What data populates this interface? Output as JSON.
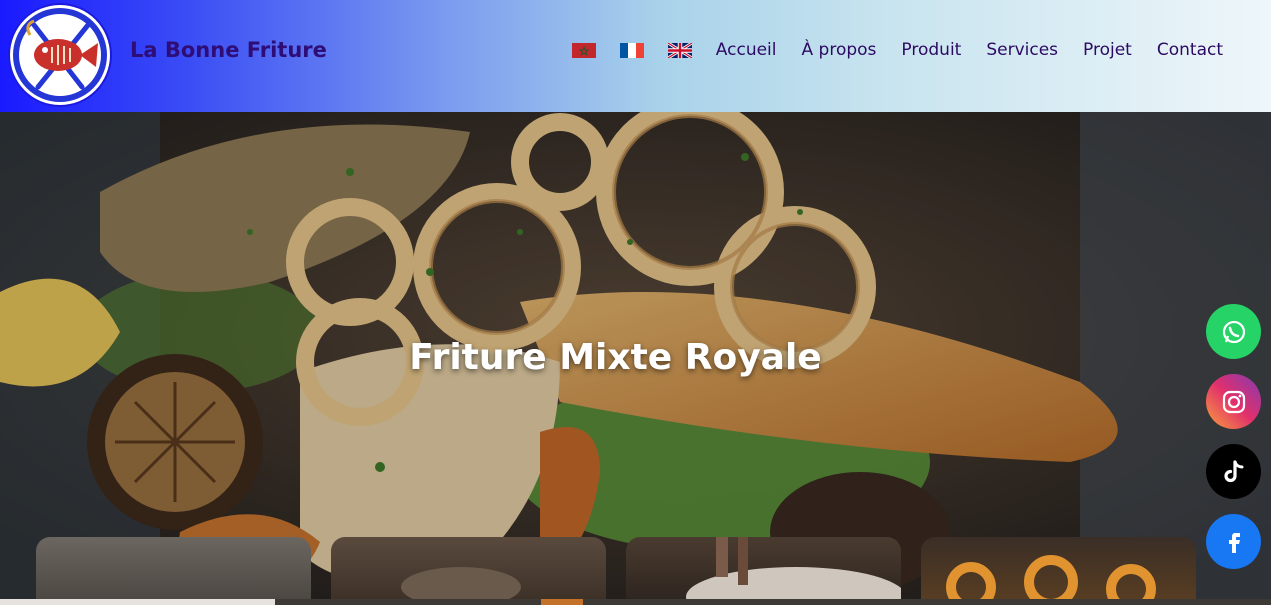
{
  "header": {
    "brand": "La Bonne Friture",
    "nav": [
      "Accueil",
      "À propos",
      "Produit",
      "Services",
      "Projet",
      "Contact"
    ],
    "languages": [
      {
        "name": "morocco-flag-icon"
      },
      {
        "name": "france-flag-icon"
      },
      {
        "name": "uk-flag-icon"
      }
    ]
  },
  "hero": {
    "title": "Friture Mixte Royale"
  },
  "social": [
    {
      "name": "whatsapp-icon",
      "color": "#25d366"
    },
    {
      "name": "instagram-icon",
      "color": "#e1306c"
    },
    {
      "name": "tiktok-icon",
      "color": "#000000"
    },
    {
      "name": "facebook-icon",
      "color": "#1877f2"
    }
  ],
  "colors": {
    "brand_text": "#2f0d77",
    "nav_text": "#2c0a63",
    "header_start": "#1a1aff",
    "header_end": "#eef6fa"
  }
}
